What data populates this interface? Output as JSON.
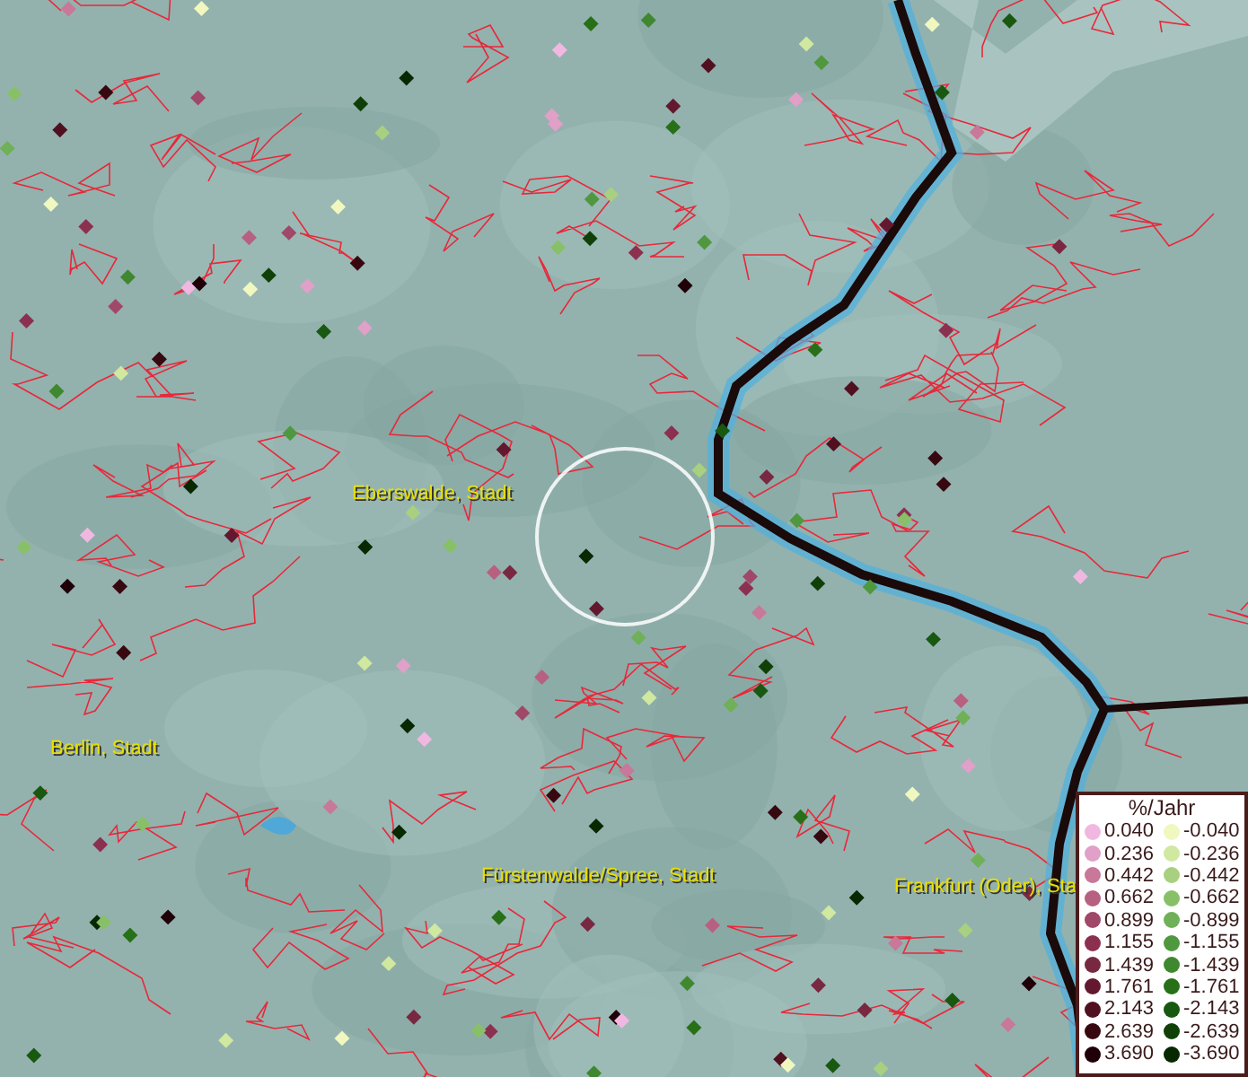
{
  "map": {
    "place_labels": [
      "Eberswalde, Stadt",
      "Berlin, Stadt",
      "Fürstenwalde/Spree, Stadt",
      "Frankfurt (Oder), Sta"
    ]
  },
  "legend": {
    "title": "%/Jahr",
    "entries": [
      {
        "label": "0.040",
        "color": "#f0b8e0"
      },
      {
        "label": "-0.040",
        "color": "#f0f8c0"
      },
      {
        "label": "0.236",
        "color": "#e0a0c8"
      },
      {
        "label": "-0.236",
        "color": "#d0e8a0"
      },
      {
        "label": "0.442",
        "color": "#c87898"
      },
      {
        "label": "-0.442",
        "color": "#a8d080"
      },
      {
        "label": "0.662",
        "color": "#b86080"
      },
      {
        "label": "-0.662",
        "color": "#88c068"
      },
      {
        "label": "0.899",
        "color": "#a04868"
      },
      {
        "label": "-0.899",
        "color": "#70b058"
      },
      {
        "label": "1.155",
        "color": "#8c3050"
      },
      {
        "label": "-1.155",
        "color": "#509840"
      },
      {
        "label": "1.439",
        "color": "#782840"
      },
      {
        "label": "-1.439",
        "color": "#408830"
      },
      {
        "label": "1.761",
        "color": "#641830"
      },
      {
        "label": "-1.761",
        "color": "#287018"
      },
      {
        "label": "2.143",
        "color": "#501020"
      },
      {
        "label": "-2.143",
        "color": "#185810"
      },
      {
        "label": "2.639",
        "color": "#380810"
      },
      {
        "label": "-2.639",
        "color": "#104008"
      },
      {
        "label": "3.690",
        "color": "#200008"
      },
      {
        "label": "-3.690",
        "color": "#082800"
      }
    ]
  }
}
